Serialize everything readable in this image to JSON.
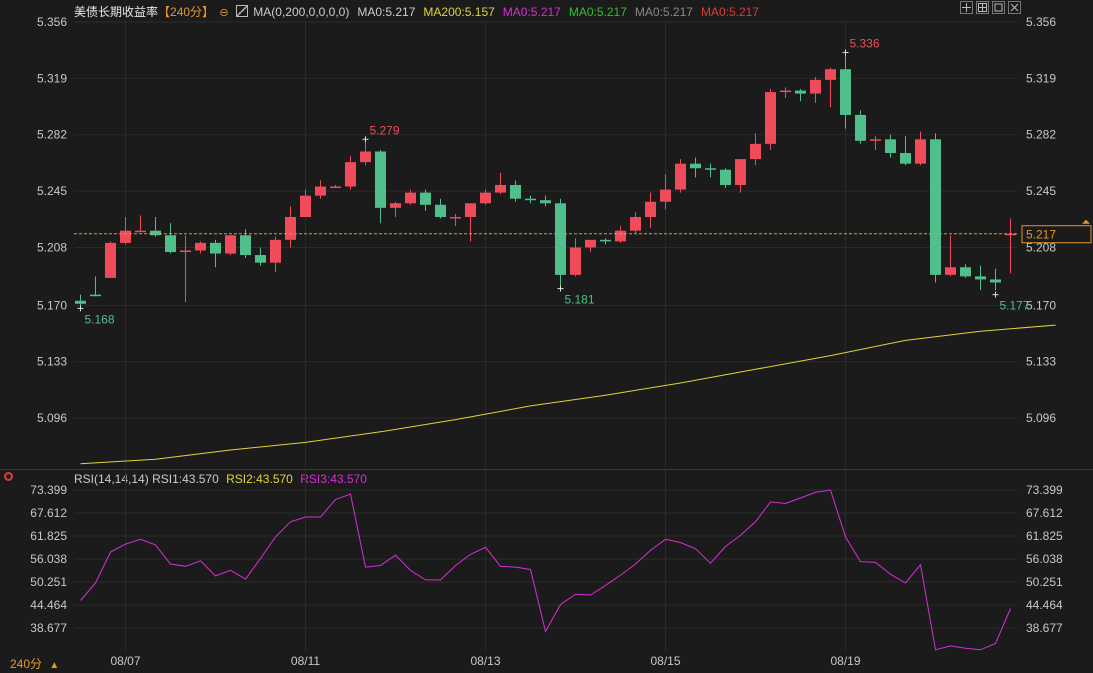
{
  "header": {
    "title": "美债长期收益率",
    "period_tag": "【240分】",
    "indicators": [
      {
        "text": "MA(0,200,0,0,0,0)",
        "color": "#cccccc"
      },
      {
        "text": "MA0:5.217",
        "color": "#cccccc"
      },
      {
        "text": "MA200:5.157",
        "color": "#e0d43a"
      },
      {
        "text": "MA0:5.217",
        "color": "#d62fd6"
      },
      {
        "text": "MA0:5.217",
        "color": "#2fc12f"
      },
      {
        "text": "MA0:5.217",
        "color": "#8a8a8a"
      },
      {
        "text": "MA0:5.217",
        "color": "#e03a3a"
      }
    ]
  },
  "rsi_header": {
    "label": "RSI(14,14,14)",
    "rsi1": "RSI1:43.570",
    "rsi2": "RSI2:43.570",
    "rsi3": "RSI3:43.570"
  },
  "footer": {
    "period": "240分",
    "arrow": "▲"
  },
  "colors": {
    "up": "#ef4b5a",
    "down": "#4fbf8c",
    "ma200": "#e0d43a",
    "rsi": "#d62fd6",
    "price_line": "#e8952a",
    "grid": "#2b2b2b",
    "axis_text": "#c8c8c8"
  },
  "chart_data": [
    {
      "type": "candlestick",
      "y_ticks": [
        "5.356",
        "5.319",
        "5.282",
        "5.245",
        "5.208",
        "5.170",
        "5.133",
        "5.096"
      ],
      "ylim": [
        5.065,
        5.356
      ],
      "x_ticks": [
        {
          "label": "08/07",
          "index": 3
        },
        {
          "label": "08/11",
          "index": 15
        },
        {
          "label": "08/13",
          "index": 27
        },
        {
          "label": "08/15",
          "index": 39
        },
        {
          "label": "08/19",
          "index": 51
        }
      ],
      "candles": [
        [
          5.173,
          5.177,
          5.171,
          5.168
        ],
        [
          5.177,
          5.189,
          5.176,
          5.176
        ],
        [
          5.188,
          5.212,
          5.211,
          5.188
        ],
        [
          5.211,
          5.228,
          5.219,
          5.21
        ],
        [
          5.219,
          5.229,
          5.219,
          5.219
        ],
        [
          5.219,
          5.228,
          5.216,
          5.215
        ],
        [
          5.216,
          5.224,
          5.205,
          5.204
        ],
        [
          5.205,
          5.216,
          5.206,
          5.172
        ],
        [
          5.206,
          5.212,
          5.211,
          5.204
        ],
        [
          5.211,
          5.213,
          5.204,
          5.195
        ],
        [
          5.204,
          5.216,
          5.216,
          5.203
        ],
        [
          5.216,
          5.22,
          5.203,
          5.201
        ],
        [
          5.203,
          5.208,
          5.198,
          5.196
        ],
        [
          5.198,
          5.215,
          5.213,
          5.192
        ],
        [
          5.213,
          5.235,
          5.228,
          5.208
        ],
        [
          5.228,
          5.246,
          5.242,
          5.228
        ],
        [
          5.242,
          5.252,
          5.248,
          5.24
        ],
        [
          5.248,
          5.249,
          5.248,
          5.247
        ],
        [
          5.248,
          5.268,
          5.264,
          5.246
        ],
        [
          5.264,
          5.279,
          5.271,
          5.262
        ],
        [
          5.271,
          5.272,
          5.234,
          5.224
        ],
        [
          5.234,
          5.238,
          5.237,
          5.228
        ],
        [
          5.237,
          5.246,
          5.244,
          5.236
        ],
        [
          5.244,
          5.246,
          5.236,
          5.232
        ],
        [
          5.236,
          5.24,
          5.228,
          5.227
        ],
        [
          5.228,
          5.23,
          5.228,
          5.222
        ],
        [
          5.228,
          5.236,
          5.237,
          5.212
        ],
        [
          5.237,
          5.246,
          5.244,
          5.236
        ],
        [
          5.244,
          5.257,
          5.249,
          5.243
        ],
        [
          5.249,
          5.252,
          5.24,
          5.238
        ],
        [
          5.24,
          5.242,
          5.239,
          5.237
        ],
        [
          5.239,
          5.242,
          5.237,
          5.235
        ],
        [
          5.237,
          5.24,
          5.19,
          5.181
        ],
        [
          5.19,
          5.214,
          5.208,
          5.189
        ],
        [
          5.208,
          5.212,
          5.213,
          5.205
        ],
        [
          5.213,
          5.214,
          5.212,
          5.21
        ],
        [
          5.212,
          5.222,
          5.219,
          5.211
        ],
        [
          5.219,
          5.231,
          5.228,
          5.217
        ],
        [
          5.228,
          5.244,
          5.238,
          5.221
        ],
        [
          5.238,
          5.256,
          5.246,
          5.233
        ],
        [
          5.246,
          5.266,
          5.263,
          5.244
        ],
        [
          5.263,
          5.267,
          5.26,
          5.254
        ],
        [
          5.26,
          5.263,
          5.259,
          5.254
        ],
        [
          5.259,
          5.26,
          5.249,
          5.247
        ],
        [
          5.249,
          5.266,
          5.266,
          5.244
        ],
        [
          5.266,
          5.283,
          5.276,
          5.262
        ],
        [
          5.276,
          5.312,
          5.31,
          5.272
        ],
        [
          5.31,
          5.313,
          5.311,
          5.306
        ],
        [
          5.311,
          5.312,
          5.309,
          5.304
        ],
        [
          5.309,
          5.32,
          5.318,
          5.303
        ],
        [
          5.318,
          5.326,
          5.325,
          5.3
        ],
        [
          5.325,
          5.336,
          5.295,
          5.286
        ],
        [
          5.295,
          5.298,
          5.278,
          5.276
        ],
        [
          5.278,
          5.281,
          5.279,
          5.272
        ],
        [
          5.279,
          5.282,
          5.27,
          5.267
        ],
        [
          5.27,
          5.281,
          5.263,
          5.262
        ],
        [
          5.263,
          5.284,
          5.279,
          5.262
        ],
        [
          5.279,
          5.283,
          5.19,
          5.185
        ],
        [
          5.19,
          5.216,
          5.195,
          5.189
        ],
        [
          5.195,
          5.197,
          5.189,
          5.188
        ],
        [
          5.189,
          5.196,
          5.187,
          5.18
        ],
        [
          5.187,
          5.194,
          5.185,
          5.18
        ],
        [
          5.217,
          5.227,
          5.217,
          5.191
        ]
      ],
      "candle_order": [
        "open",
        "high",
        "close",
        "low"
      ],
      "last_price": 5.217,
      "annotations": [
        {
          "label": "5.168",
          "index": 0,
          "value": 5.168,
          "kind": "low"
        },
        {
          "label": "5.279",
          "index": 19,
          "value": 5.279,
          "kind": "high"
        },
        {
          "label": "5.181",
          "index": 32,
          "value": 5.181,
          "kind": "low"
        },
        {
          "label": "5.336",
          "index": 51,
          "value": 5.336,
          "kind": "high"
        },
        {
          "label": "5.177",
          "index": 61,
          "value": 5.177,
          "kind": "low"
        }
      ],
      "ma200": {
        "name": "MA200",
        "points": [
          [
            0,
            5.066
          ],
          [
            5,
            5.069
          ],
          [
            10,
            5.075
          ],
          [
            15,
            5.08
          ],
          [
            20,
            5.087
          ],
          [
            25,
            5.095
          ],
          [
            30,
            5.104
          ],
          [
            35,
            5.111
          ],
          [
            40,
            5.119
          ],
          [
            45,
            5.128
          ],
          [
            50,
            5.137
          ],
          [
            55,
            5.147
          ],
          [
            60,
            5.153
          ],
          [
            65,
            5.157
          ]
        ]
      }
    },
    {
      "type": "line",
      "name": "RSI",
      "y_ticks": [
        "73.399",
        "67.612",
        "61.825",
        "56.038",
        "50.251",
        "44.464",
        "38.677"
      ],
      "ylim": [
        32.0,
        73.4
      ],
      "values": [
        45.6,
        50.0,
        57.8,
        59.8,
        61.0,
        59.6,
        54.8,
        54.2,
        55.6,
        51.8,
        53.2,
        51.0,
        56.2,
        61.6,
        65.4,
        66.6,
        66.6,
        71.0,
        72.4,
        54.0,
        54.4,
        57.0,
        53.2,
        50.8,
        50.8,
        54.4,
        57.2,
        59.0,
        54.2,
        54.0,
        53.4,
        37.8,
        44.6,
        47.2,
        47.0,
        49.4,
        52.0,
        54.8,
        58.2,
        61.0,
        60.2,
        58.6,
        55.0,
        59.2,
        62.0,
        65.4,
        70.4,
        70.0,
        71.4,
        72.8,
        73.4,
        61.6,
        55.4,
        55.2,
        52.2,
        50.0,
        54.6,
        33.2,
        34.2,
        33.6,
        33.2,
        34.8,
        43.6
      ]
    }
  ]
}
